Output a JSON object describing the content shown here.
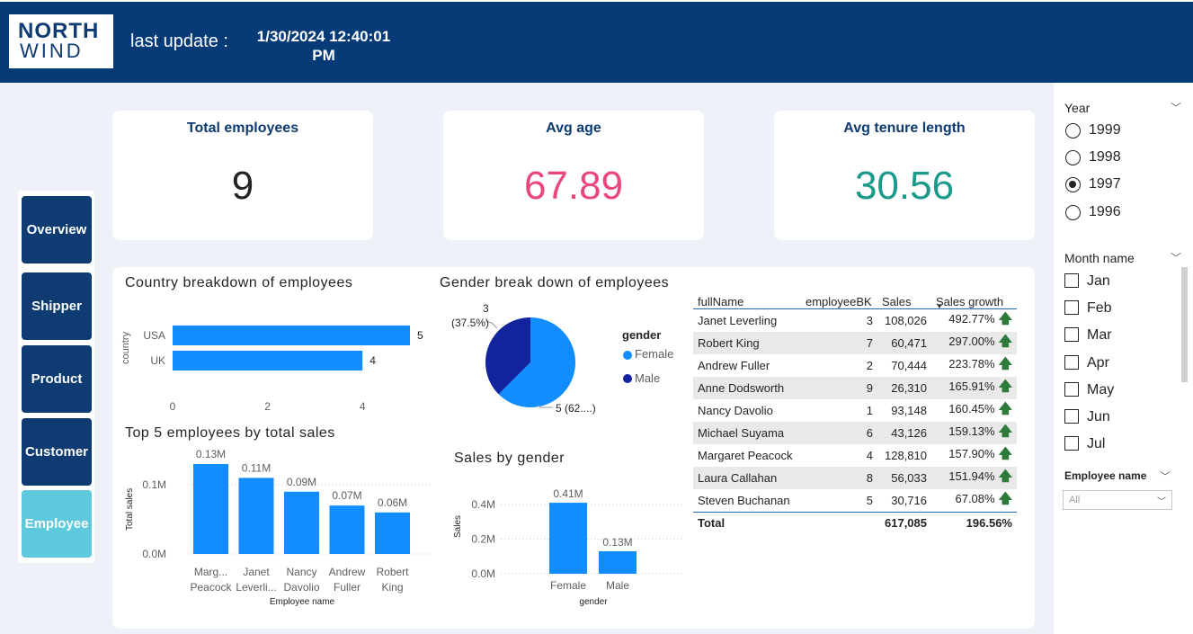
{
  "header": {
    "logo_top": "NORTH",
    "logo_bottom": "WIND",
    "last_update_label": "last update :",
    "last_update_date": "1/30/2024 12:40:01",
    "last_update_time": "PM"
  },
  "nav": {
    "items": [
      "Overview",
      "Shipper",
      "Product",
      "Customer",
      "Employee"
    ],
    "active": "Employee"
  },
  "kpis": [
    {
      "title": "Total employees",
      "value": "9",
      "color": "#252423"
    },
    {
      "title": "Avg age",
      "value": "67.89",
      "color": "#e8467c"
    },
    {
      "title": "Avg tenure length",
      "value": "30.56",
      "color": "#1a9a8a"
    }
  ],
  "country_chart": {
    "title": "Country breakdown of employees",
    "ylabel": "country",
    "ticks": [
      "0",
      "2",
      "4"
    ]
  },
  "gender_pie": {
    "title": "Gender break down of employees",
    "label_male_value": "3",
    "label_male_pct": "(37.5%)",
    "label_female": "5 (62....)",
    "legend_title": "gender",
    "legend": [
      "Female",
      "Male"
    ]
  },
  "top5_chart": {
    "title": "Top 5 employees by total sales",
    "ylabel": "Total sales",
    "xlabel": "Employee name",
    "yticks": [
      "0.1M",
      "0.0M"
    ]
  },
  "gender_sales": {
    "title": "Sales by gender",
    "ylabel": "Sales",
    "xlabel": "gender",
    "yticks": [
      "0.4M",
      "0.2M",
      "0.0M"
    ]
  },
  "chart_data": [
    {
      "type": "bar",
      "orientation": "horizontal",
      "title": "Country breakdown of employees",
      "ylabel": "country",
      "categories": [
        "USA",
        "UK"
      ],
      "values": [
        5,
        4
      ],
      "xlim": [
        0,
        5
      ]
    },
    {
      "type": "pie",
      "title": "Gender break down of employees",
      "categories": [
        "Female",
        "Male"
      ],
      "values": [
        5,
        3
      ],
      "colors": [
        "#118dff",
        "#12239e"
      ]
    },
    {
      "type": "bar",
      "title": "Top 5 employees by total sales",
      "xlabel": "Employee name",
      "ylabel": "Total sales",
      "categories": [
        "Marg... Peacock",
        "Janet Leverli...",
        "Nancy Davolio",
        "Andrew Fuller",
        "Robert King"
      ],
      "values": [
        0.13,
        0.11,
        0.09,
        0.07,
        0.06
      ],
      "data_labels": [
        "0.13M",
        "0.11M",
        "0.09M",
        "0.07M",
        "0.06M"
      ],
      "ylim": [
        0,
        0.14
      ],
      "unit": "M"
    },
    {
      "type": "bar",
      "title": "Sales by gender",
      "xlabel": "gender",
      "ylabel": "Sales",
      "categories": [
        "Female",
        "Male"
      ],
      "values": [
        0.41,
        0.13
      ],
      "data_labels": [
        "0.41M",
        "0.13M"
      ],
      "ylim": [
        0,
        0.45
      ],
      "unit": "M"
    }
  ],
  "table": {
    "columns": [
      "fullName",
      "employeeBK",
      "Sales",
      "Sales growth"
    ],
    "rows": [
      [
        "Janet Leverling",
        "3",
        "108,026",
        "492.77%"
      ],
      [
        "Robert King",
        "7",
        "60,471",
        "297.00%"
      ],
      [
        "Andrew Fuller",
        "2",
        "70,444",
        "223.78%"
      ],
      [
        "Anne Dodsworth",
        "9",
        "26,310",
        "165.91%"
      ],
      [
        "Nancy Davolio",
        "1",
        "93,148",
        "160.45%"
      ],
      [
        "Michael Suyama",
        "6",
        "43,126",
        "159.13%"
      ],
      [
        "Margaret Peacock",
        "4",
        "128,810",
        "157.90%"
      ],
      [
        "Laura Callahan",
        "8",
        "56,033",
        "151.94%"
      ],
      [
        "Steven Buchanan",
        "5",
        "30,716",
        "67.08%"
      ]
    ],
    "total": [
      "Total",
      "",
      "617,085",
      "196.56%"
    ]
  },
  "slicers": {
    "year_title": "Year",
    "years": [
      "1999",
      "1998",
      "1997",
      "1996"
    ],
    "selected_year": "1997",
    "month_title": "Month name",
    "months": [
      "Jan",
      "Feb",
      "Mar",
      "Apr",
      "May",
      "Jun",
      "Jul"
    ],
    "employee_title": "Employee name",
    "employee_value": "All"
  }
}
